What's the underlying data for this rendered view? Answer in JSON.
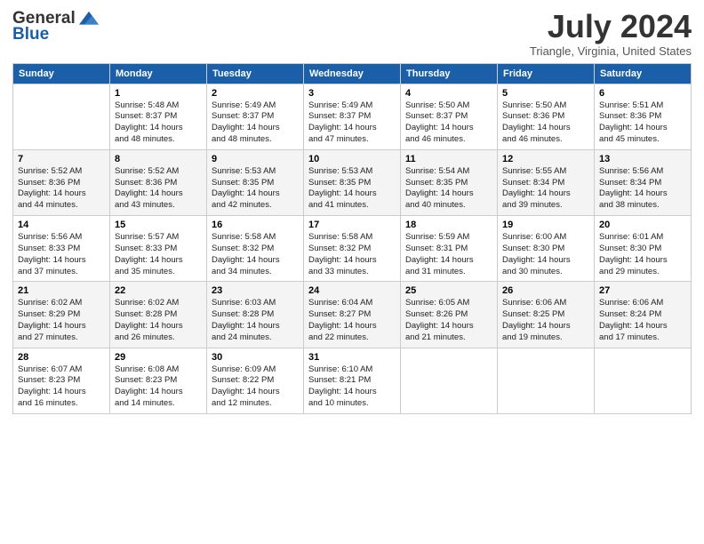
{
  "logo": {
    "general": "General",
    "blue": "Blue"
  },
  "title": "July 2024",
  "location": "Triangle, Virginia, United States",
  "weekdays": [
    "Sunday",
    "Monday",
    "Tuesday",
    "Wednesday",
    "Thursday",
    "Friday",
    "Saturday"
  ],
  "weeks": [
    [
      {
        "day": "",
        "info": ""
      },
      {
        "day": "1",
        "info": "Sunrise: 5:48 AM\nSunset: 8:37 PM\nDaylight: 14 hours\nand 48 minutes."
      },
      {
        "day": "2",
        "info": "Sunrise: 5:49 AM\nSunset: 8:37 PM\nDaylight: 14 hours\nand 48 minutes."
      },
      {
        "day": "3",
        "info": "Sunrise: 5:49 AM\nSunset: 8:37 PM\nDaylight: 14 hours\nand 47 minutes."
      },
      {
        "day": "4",
        "info": "Sunrise: 5:50 AM\nSunset: 8:37 PM\nDaylight: 14 hours\nand 46 minutes."
      },
      {
        "day": "5",
        "info": "Sunrise: 5:50 AM\nSunset: 8:36 PM\nDaylight: 14 hours\nand 46 minutes."
      },
      {
        "day": "6",
        "info": "Sunrise: 5:51 AM\nSunset: 8:36 PM\nDaylight: 14 hours\nand 45 minutes."
      }
    ],
    [
      {
        "day": "7",
        "info": "Sunrise: 5:52 AM\nSunset: 8:36 PM\nDaylight: 14 hours\nand 44 minutes."
      },
      {
        "day": "8",
        "info": "Sunrise: 5:52 AM\nSunset: 8:36 PM\nDaylight: 14 hours\nand 43 minutes."
      },
      {
        "day": "9",
        "info": "Sunrise: 5:53 AM\nSunset: 8:35 PM\nDaylight: 14 hours\nand 42 minutes."
      },
      {
        "day": "10",
        "info": "Sunrise: 5:53 AM\nSunset: 8:35 PM\nDaylight: 14 hours\nand 41 minutes."
      },
      {
        "day": "11",
        "info": "Sunrise: 5:54 AM\nSunset: 8:35 PM\nDaylight: 14 hours\nand 40 minutes."
      },
      {
        "day": "12",
        "info": "Sunrise: 5:55 AM\nSunset: 8:34 PM\nDaylight: 14 hours\nand 39 minutes."
      },
      {
        "day": "13",
        "info": "Sunrise: 5:56 AM\nSunset: 8:34 PM\nDaylight: 14 hours\nand 38 minutes."
      }
    ],
    [
      {
        "day": "14",
        "info": "Sunrise: 5:56 AM\nSunset: 8:33 PM\nDaylight: 14 hours\nand 37 minutes."
      },
      {
        "day": "15",
        "info": "Sunrise: 5:57 AM\nSunset: 8:33 PM\nDaylight: 14 hours\nand 35 minutes."
      },
      {
        "day": "16",
        "info": "Sunrise: 5:58 AM\nSunset: 8:32 PM\nDaylight: 14 hours\nand 34 minutes."
      },
      {
        "day": "17",
        "info": "Sunrise: 5:58 AM\nSunset: 8:32 PM\nDaylight: 14 hours\nand 33 minutes."
      },
      {
        "day": "18",
        "info": "Sunrise: 5:59 AM\nSunset: 8:31 PM\nDaylight: 14 hours\nand 31 minutes."
      },
      {
        "day": "19",
        "info": "Sunrise: 6:00 AM\nSunset: 8:30 PM\nDaylight: 14 hours\nand 30 minutes."
      },
      {
        "day": "20",
        "info": "Sunrise: 6:01 AM\nSunset: 8:30 PM\nDaylight: 14 hours\nand 29 minutes."
      }
    ],
    [
      {
        "day": "21",
        "info": "Sunrise: 6:02 AM\nSunset: 8:29 PM\nDaylight: 14 hours\nand 27 minutes."
      },
      {
        "day": "22",
        "info": "Sunrise: 6:02 AM\nSunset: 8:28 PM\nDaylight: 14 hours\nand 26 minutes."
      },
      {
        "day": "23",
        "info": "Sunrise: 6:03 AM\nSunset: 8:28 PM\nDaylight: 14 hours\nand 24 minutes."
      },
      {
        "day": "24",
        "info": "Sunrise: 6:04 AM\nSunset: 8:27 PM\nDaylight: 14 hours\nand 22 minutes."
      },
      {
        "day": "25",
        "info": "Sunrise: 6:05 AM\nSunset: 8:26 PM\nDaylight: 14 hours\nand 21 minutes."
      },
      {
        "day": "26",
        "info": "Sunrise: 6:06 AM\nSunset: 8:25 PM\nDaylight: 14 hours\nand 19 minutes."
      },
      {
        "day": "27",
        "info": "Sunrise: 6:06 AM\nSunset: 8:24 PM\nDaylight: 14 hours\nand 17 minutes."
      }
    ],
    [
      {
        "day": "28",
        "info": "Sunrise: 6:07 AM\nSunset: 8:23 PM\nDaylight: 14 hours\nand 16 minutes."
      },
      {
        "day": "29",
        "info": "Sunrise: 6:08 AM\nSunset: 8:23 PM\nDaylight: 14 hours\nand 14 minutes."
      },
      {
        "day": "30",
        "info": "Sunrise: 6:09 AM\nSunset: 8:22 PM\nDaylight: 14 hours\nand 12 minutes."
      },
      {
        "day": "31",
        "info": "Sunrise: 6:10 AM\nSunset: 8:21 PM\nDaylight: 14 hours\nand 10 minutes."
      },
      {
        "day": "",
        "info": ""
      },
      {
        "day": "",
        "info": ""
      },
      {
        "day": "",
        "info": ""
      }
    ]
  ]
}
